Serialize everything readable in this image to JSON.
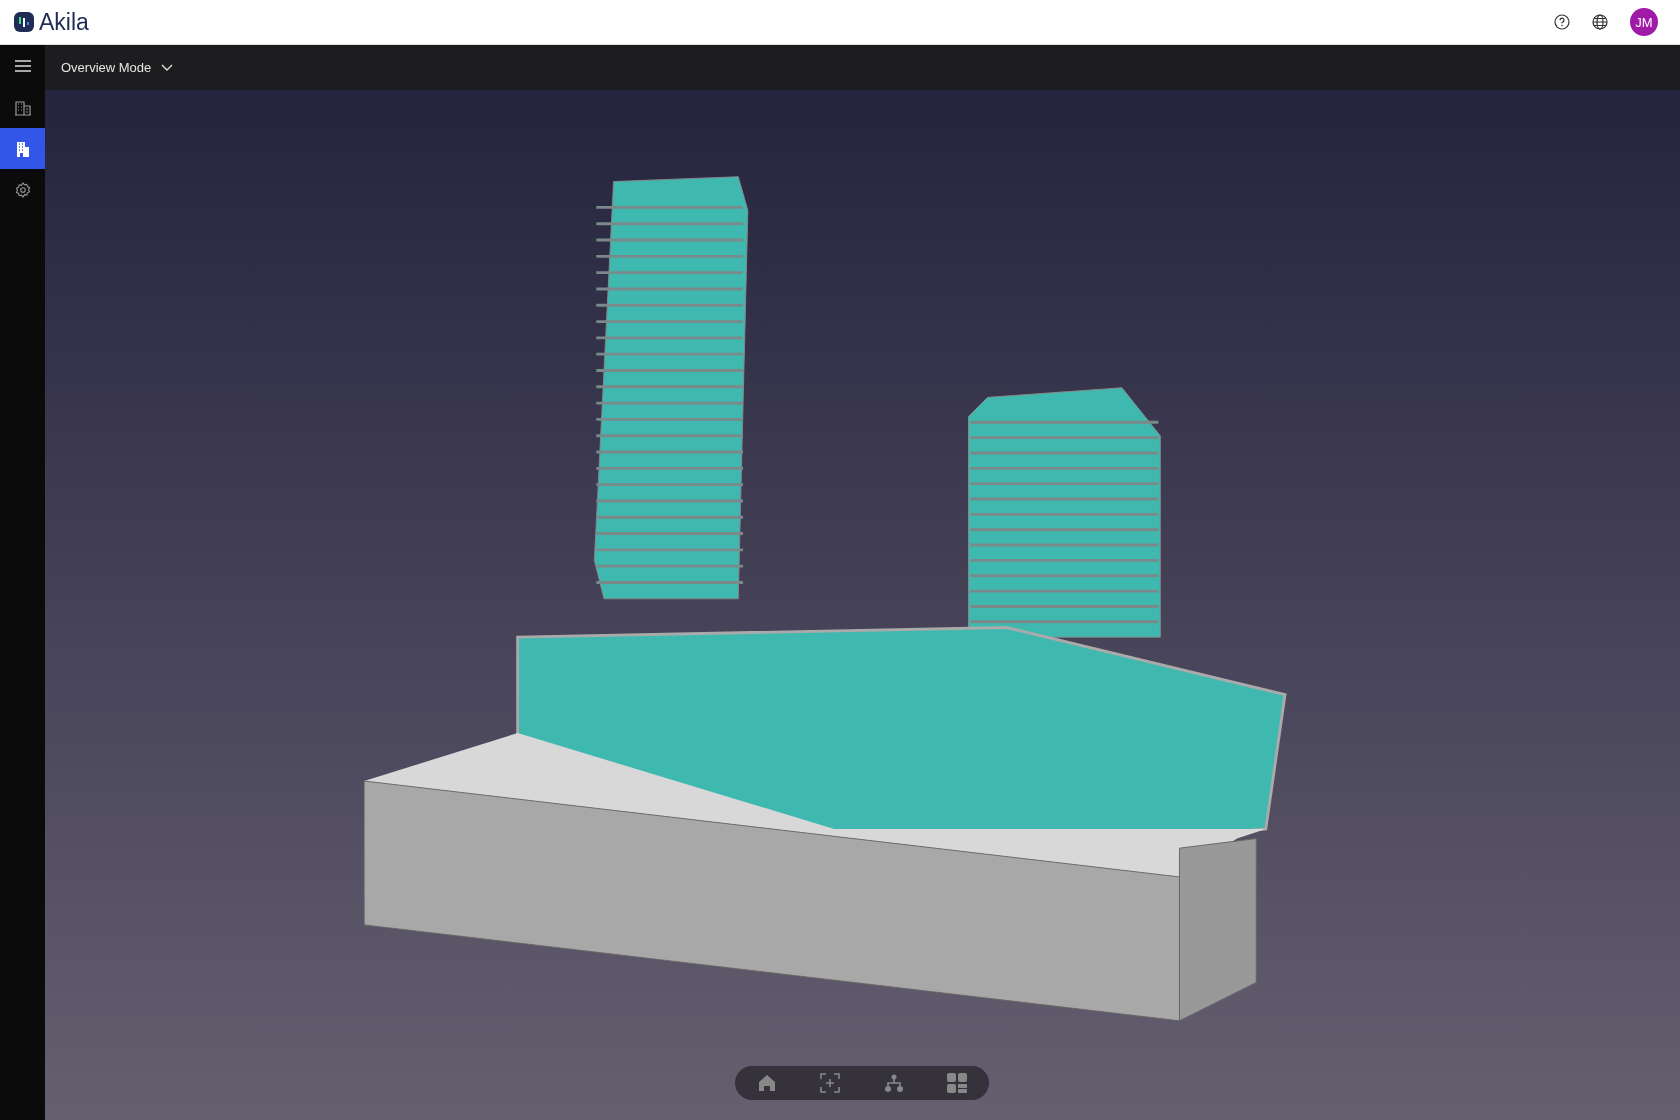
{
  "header": {
    "brand": "Akila",
    "avatar": {
      "initials": "JM"
    }
  },
  "sidebar": {
    "items": [
      {
        "kind": "buildings",
        "selected": false
      },
      {
        "kind": "building",
        "selected": true
      },
      {
        "kind": "settings",
        "selected": false
      }
    ]
  },
  "mode_selector": {
    "label": "Overview Mode"
  },
  "viewer_toolbar": {
    "items": [
      {
        "kind": "home"
      },
      {
        "kind": "focus"
      },
      {
        "kind": "tree"
      },
      {
        "kind": "layout"
      }
    ]
  }
}
